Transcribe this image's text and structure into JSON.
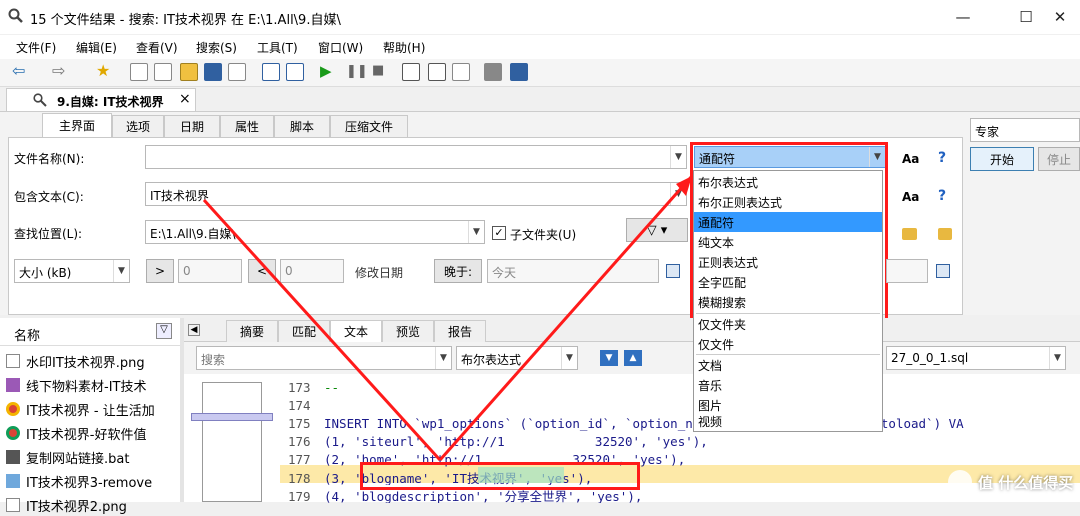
{
  "window": {
    "title": "15 个文件结果 - 搜索: IT技术视界 在 E:\\1.All\\9.自媒\\",
    "min": "—",
    "max": "☐",
    "close": "✕"
  },
  "menu": [
    "文件(F)",
    "编辑(E)",
    "查看(V)",
    "搜索(S)",
    "工具(T)",
    "窗口(W)",
    "帮助(H)"
  ],
  "doc_tab": {
    "label": "9.自媒: IT技术视界",
    "close": "×"
  },
  "subtabs": [
    "主界面",
    "选项",
    "日期",
    "属性",
    "脚本",
    "压缩文件"
  ],
  "form": {
    "filename_label": "文件名称(N):",
    "filename_value": "",
    "contains_label": "包含文本(C):",
    "contains_value": "IT技术视界",
    "location_label": "查找位置(L):",
    "location_value": "E:\\1.All\\9.自媒\\",
    "subfolder_label": "子文件夹(U)",
    "size_select": "大小 (kB)",
    "size_min": "0",
    "size_max": "0",
    "modified_label": "修改日期",
    "later_btn": "晚于:",
    "date_value": "今天",
    "mode_value": "通配符",
    "aa": "Aa",
    "help": "?"
  },
  "right": {
    "expert_label": "专家",
    "start": "开始",
    "stop": "停止"
  },
  "dropdown_options": [
    "布尔表达式",
    "布尔正则表达式",
    "通配符",
    "纯文本",
    "正则表达式",
    "全字匹配",
    "模糊搜索",
    "仅文件夹",
    "仅文件",
    "文档",
    "音乐",
    "图片",
    "视频"
  ],
  "dropdown_selected": "通配符",
  "results": {
    "header": "名称",
    "items": [
      "水印IT技术视界.png",
      "线下物料素材-IT技术",
      "IT技术视界 - 让生活加",
      "IT技术视界-好软件值",
      "复制网站链接.bat",
      "IT技术视界3-remove",
      "IT技术视界2.png"
    ]
  },
  "preview_tabs": [
    "摘要",
    "匹配",
    "文本",
    "预览",
    "报告"
  ],
  "preview_toolbar": {
    "search_placeholder": "搜索",
    "mode": "布尔表达式",
    "file": "27_0_0_1.sql"
  },
  "code": [
    {
      "n": "173",
      "t": "--"
    },
    {
      "n": "174",
      "t": ""
    },
    {
      "n": "175",
      "t": "INSERT INTO `wp1_options` (`option_id`, `option_name`, `option_value`, `autoload`) VA"
    },
    {
      "n": "176",
      "t": "(1, 'siteurl', 'http://1            32520', 'yes'),"
    },
    {
      "n": "177",
      "t": "(2, 'home', 'http://1            32520', 'yes'),"
    },
    {
      "n": "178",
      "t": "(3, 'blogname', 'IT技术视界', 'yes'),"
    },
    {
      "n": "179",
      "t": "(4, 'blogdescription', '分享全世界', 'yes'),"
    }
  ],
  "watermark": "值 什么值得买"
}
